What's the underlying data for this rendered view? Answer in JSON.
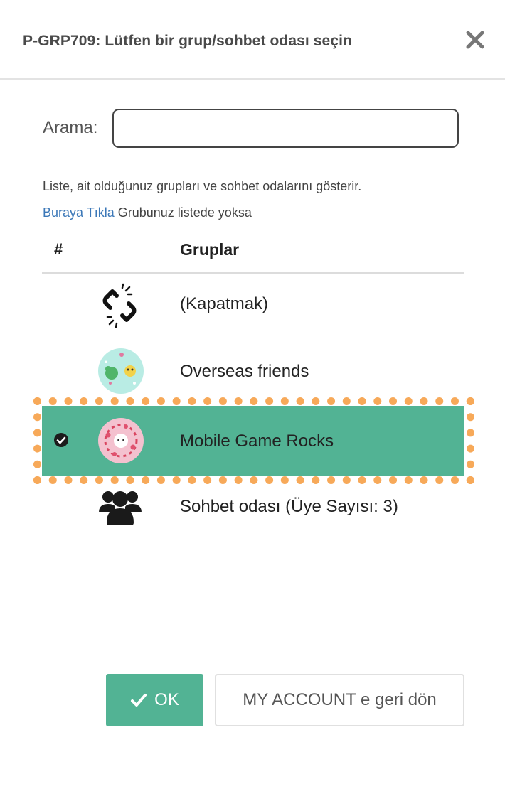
{
  "dialog": {
    "title": "P-GRP709: Lütfen bir grup/sohbet odası seçin",
    "close_icon": "close-icon"
  },
  "search": {
    "label": "Arama:",
    "value": "",
    "placeholder": ""
  },
  "info": {
    "description": "Liste, ait olduğunuz grupları ve sohbet odalarını gösterir.",
    "link_text": "Buraya Tıkla",
    "link_suffix": " Grubunuz listede yoksa"
  },
  "table": {
    "headers": {
      "number": "#",
      "groups": "Gruplar"
    },
    "rows": [
      {
        "label": "(Kapatmak)",
        "icon": "broken-link-icon",
        "selected": false
      },
      {
        "label": "Overseas friends",
        "icon": "group-avatar-icon",
        "selected": false
      },
      {
        "label": "Mobile Game Rocks",
        "icon": "group-avatar-icon",
        "selected": true
      },
      {
        "label": "Sohbet odası (Üye Sayısı: 3)",
        "icon": "users-icon",
        "selected": false
      }
    ]
  },
  "colors": {
    "accent": "#52b394",
    "link": "#3c78b8",
    "highlight": "#f7a959"
  },
  "buttons": {
    "ok_label": "OK",
    "account_label": "MY ACCOUNT e geri dön"
  }
}
